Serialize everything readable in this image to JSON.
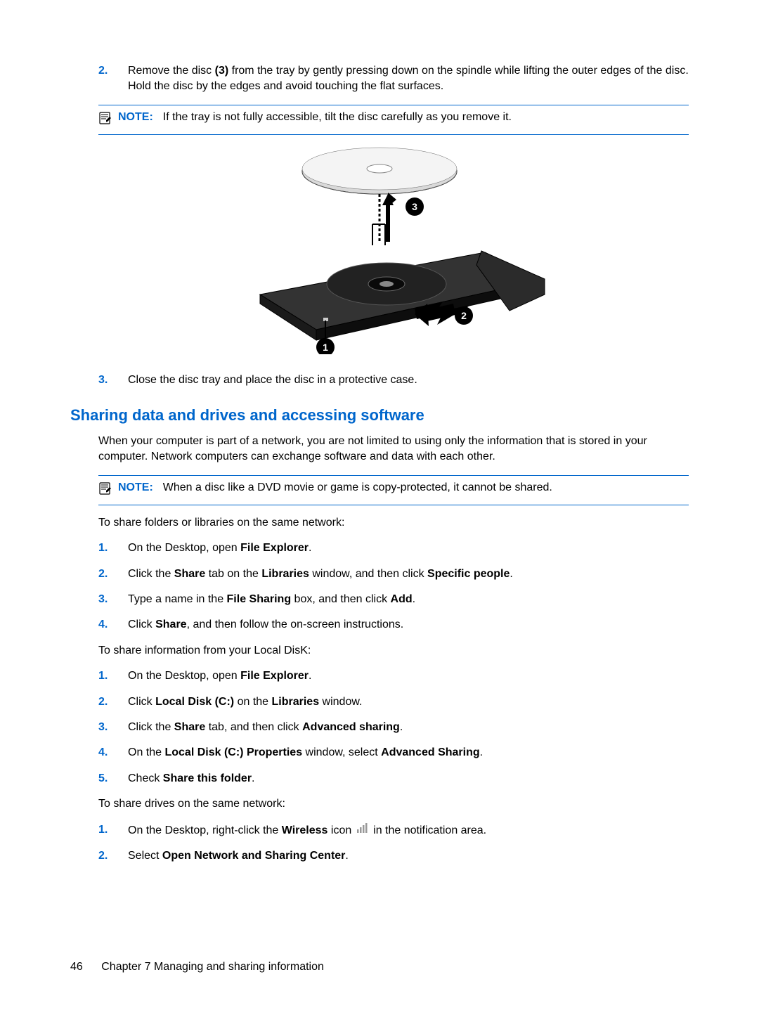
{
  "steps_top": [
    {
      "num": "2.",
      "parts": [
        {
          "t": "Remove the disc "
        },
        {
          "t": "(3)",
          "b": true
        },
        {
          "t": " from the tray by gently pressing down on the spindle while lifting the outer edges of the disc. Hold the disc by the edges and avoid touching the flat surfaces."
        }
      ]
    }
  ],
  "note1": {
    "label": "NOTE:",
    "text": "If the tray is not fully accessible, tilt the disc carefully as you remove it."
  },
  "steps_after_fig": [
    {
      "num": "3.",
      "parts": [
        {
          "t": "Close the disc tray and place the disc in a protective case."
        }
      ]
    }
  ],
  "heading": "Sharing data and drives and accessing software",
  "intro": "When your computer is part of a network, you are not limited to using only the information that is stored in your computer. Network computers can exchange software and data with each other.",
  "note2": {
    "label": "NOTE:",
    "text": "When a disc like a DVD movie or game is copy-protected, it cannot be shared."
  },
  "share_folders_intro": "To share folders or libraries on the same network:",
  "share_folders_steps": [
    {
      "num": "1.",
      "parts": [
        {
          "t": "On the Desktop, open "
        },
        {
          "t": "File Explorer",
          "b": true
        },
        {
          "t": "."
        }
      ]
    },
    {
      "num": "2.",
      "parts": [
        {
          "t": "Click the "
        },
        {
          "t": "Share",
          "b": true
        },
        {
          "t": " tab on the "
        },
        {
          "t": "Libraries",
          "b": true
        },
        {
          "t": " window, and then click "
        },
        {
          "t": "Specific people",
          "b": true
        },
        {
          "t": "."
        }
      ]
    },
    {
      "num": "3.",
      "parts": [
        {
          "t": "Type a name in the "
        },
        {
          "t": "File Sharing",
          "b": true
        },
        {
          "t": " box, and then click "
        },
        {
          "t": "Add",
          "b": true
        },
        {
          "t": "."
        }
      ]
    },
    {
      "num": "4.",
      "parts": [
        {
          "t": "Click "
        },
        {
          "t": "Share",
          "b": true
        },
        {
          "t": ", and then follow the on-screen instructions."
        }
      ]
    }
  ],
  "share_local_intro": "To share information from your Local DisK:",
  "share_local_steps": [
    {
      "num": "1.",
      "parts": [
        {
          "t": "On the Desktop, open "
        },
        {
          "t": "File Explorer",
          "b": true
        },
        {
          "t": "."
        }
      ]
    },
    {
      "num": "2.",
      "parts": [
        {
          "t": "Click "
        },
        {
          "t": "Local Disk (C:)",
          "b": true
        },
        {
          "t": " on the "
        },
        {
          "t": "Libraries",
          "b": true
        },
        {
          "t": " window."
        }
      ]
    },
    {
      "num": "3.",
      "parts": [
        {
          "t": "Click the "
        },
        {
          "t": "Share",
          "b": true
        },
        {
          "t": " tab, and then click "
        },
        {
          "t": "Advanced sharing",
          "b": true
        },
        {
          "t": "."
        }
      ]
    },
    {
      "num": "4.",
      "parts": [
        {
          "t": "On the "
        },
        {
          "t": "Local Disk (C:) Properties",
          "b": true
        },
        {
          "t": " window, select "
        },
        {
          "t": "Advanced Sharing",
          "b": true
        },
        {
          "t": "."
        }
      ]
    },
    {
      "num": "5.",
      "parts": [
        {
          "t": "Check "
        },
        {
          "t": "Share this folder",
          "b": true
        },
        {
          "t": "."
        }
      ]
    }
  ],
  "share_drives_intro": "To share drives on the same network:",
  "share_drives_steps": [
    {
      "num": "1.",
      "parts": [
        {
          "t": "On the Desktop, right-click the "
        },
        {
          "t": "Wireless",
          "b": true
        },
        {
          "t": " icon "
        },
        {
          "icon": "wireless"
        },
        {
          "t": " in the notification area."
        }
      ]
    },
    {
      "num": "2.",
      "parts": [
        {
          "t": "Select "
        },
        {
          "t": "Open Network and Sharing Center",
          "b": true
        },
        {
          "t": "."
        }
      ]
    }
  ],
  "footer": {
    "page": "46",
    "chapter": "Chapter 7   Managing and sharing information"
  }
}
